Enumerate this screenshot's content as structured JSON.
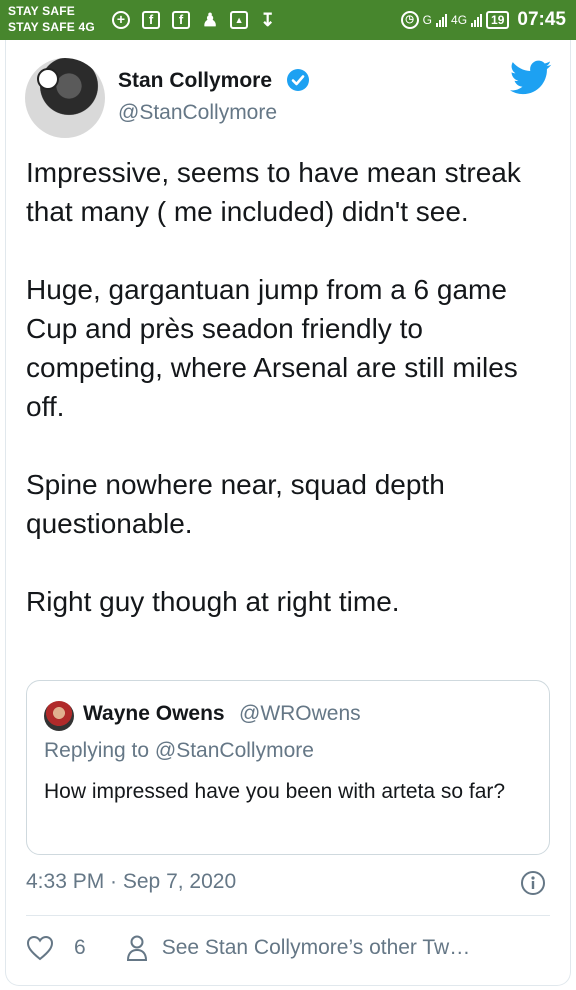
{
  "status_bar": {
    "carrier_line1": "STAY SAFE",
    "carrier_line2": "STAY SAFE 4G",
    "network_label": "G",
    "network_label2": "4G",
    "battery": "19",
    "time": "07:45",
    "background": "#47862d"
  },
  "tweet": {
    "author_name": "Stan Collymore",
    "author_handle": "@StanCollymore",
    "paragraphs": [
      "Impressive, seems to have mean streak that many ( me included) didn't see.",
      "Huge, gargantuan jump from a 6 game Cup and près seadon friendly to competing, where Arsenal are still miles off.",
      "Spine nowhere near, squad depth questionable.",
      "Right guy though at right time."
    ],
    "timestamp": "4:33 PM · Sep 7, 2020",
    "like_count": "6",
    "other_tweets_label": "See Stan Collymore’s other Tw…"
  },
  "quoted_tweet": {
    "author_name": "Wayne Owens",
    "author_handle": "@WROwens",
    "replying_to": "Replying to @StanCollymore",
    "text": "How impressed have you been with arteta so far?"
  },
  "colors": {
    "twitter_blue": "#1da1f2",
    "secondary_text": "#657786",
    "primary_text": "#14171a"
  }
}
